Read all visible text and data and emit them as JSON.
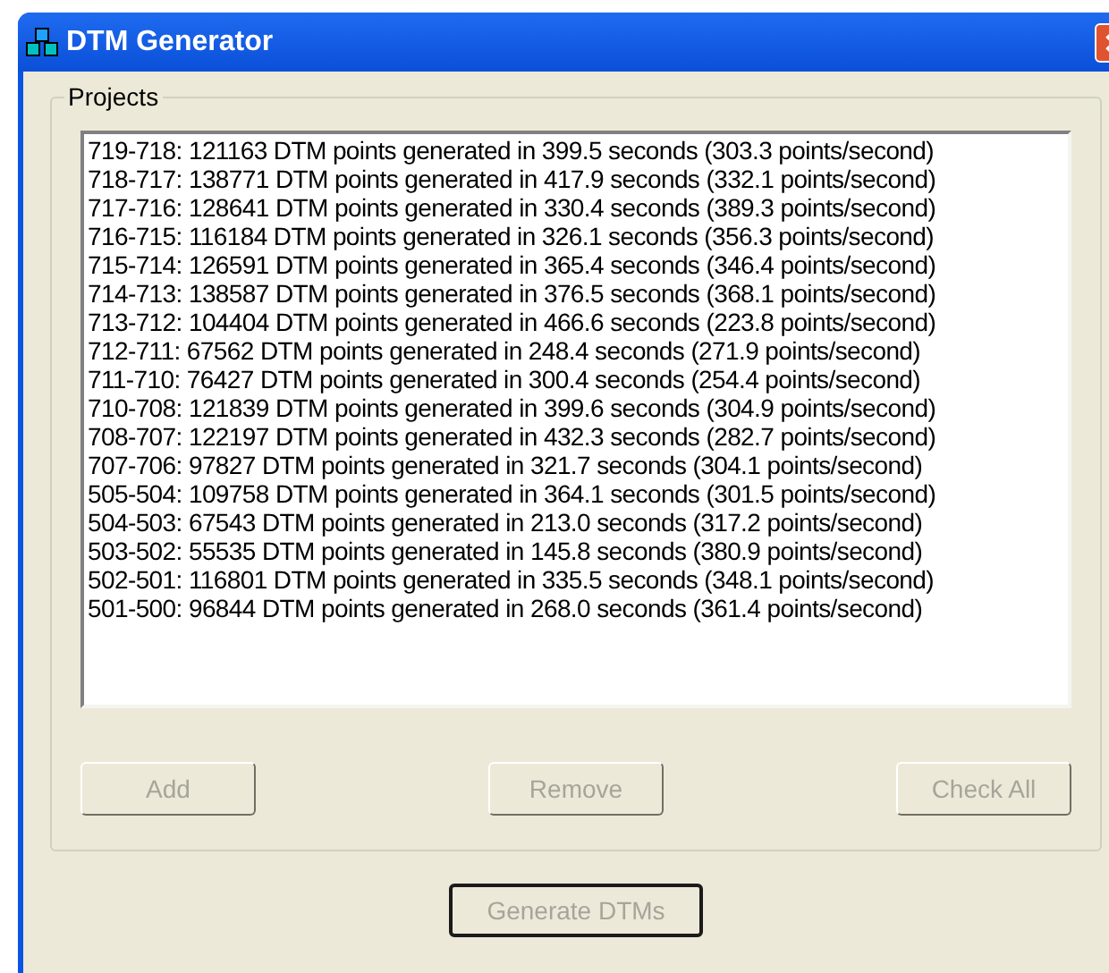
{
  "window": {
    "title": "DTM Generator"
  },
  "projects": {
    "label": "Projects",
    "items": [
      "719-718: 121163 DTM points generated in 399.5 seconds (303.3 points/second)",
      "718-717: 138771 DTM points generated in 417.9 seconds (332.1 points/second)",
      "717-716: 128641 DTM points generated in 330.4 seconds (389.3 points/second)",
      "716-715: 116184 DTM points generated in 326.1 seconds (356.3 points/second)",
      "715-714: 126591 DTM points generated in 365.4 seconds (346.4 points/second)",
      "714-713: 138587 DTM points generated in 376.5 seconds (368.1 points/second)",
      "713-712: 104404 DTM points generated in 466.6 seconds (223.8 points/second)",
      "712-711: 67562 DTM points generated in 248.4 seconds (271.9 points/second)",
      "711-710: 76427 DTM points generated in 300.4 seconds (254.4 points/second)",
      "710-708: 121839 DTM points generated in 399.6 seconds (304.9 points/second)",
      "708-707: 122197 DTM points generated in 432.3 seconds (282.7 points/second)",
      "707-706: 97827 DTM points generated in 321.7 seconds (304.1 points/second)",
      "505-504: 109758 DTM points generated in 364.1 seconds (301.5 points/second)",
      "504-503: 67543 DTM points generated in 213.0 seconds (317.2 points/second)",
      "503-502: 55535 DTM points generated in 145.8 seconds (380.9 points/second)",
      "502-501: 116801 DTM points generated in 335.5 seconds (348.1 points/second)",
      "501-500: 96844 DTM points generated in 268.0 seconds (361.4 points/second)"
    ],
    "buttons": [
      {
        "label": "Add",
        "disabled": true
      },
      {
        "label": "Remove",
        "disabled": true
      },
      {
        "label": "Check All",
        "disabled": true
      }
    ]
  },
  "generate_button": {
    "label": "Generate DTMs",
    "disabled": true
  }
}
